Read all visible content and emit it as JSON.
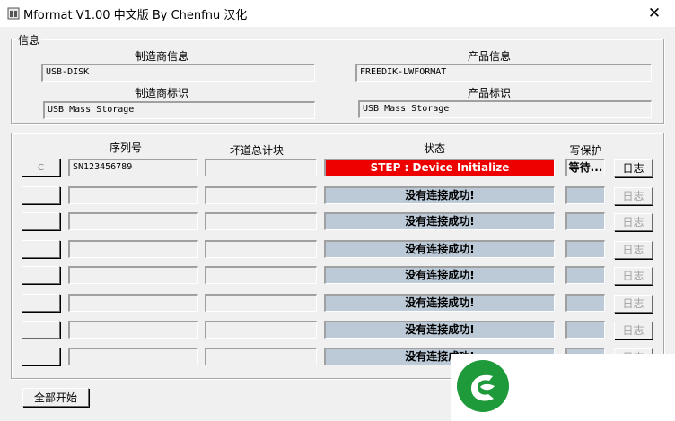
{
  "window": {
    "title": "Mformat V1.00 中文版 By Chenfnu 汉化",
    "close_glyph": "✕"
  },
  "info_group": {
    "legend": "信息",
    "manufacturer_info_label": "制造商信息",
    "manufacturer_info_value": "USB-DISK",
    "product_info_label": "产品信息",
    "product_info_value": "FREEDIK-LWFORMAT",
    "manufacturer_id_label": "制造商标识",
    "manufacturer_id_value": "USB Mass Storage",
    "product_id_label": "产品标识",
    "product_id_value": "USB Mass Storage"
  },
  "table": {
    "headers": {
      "serial": "序列号",
      "bad_blocks": "坏道总计块",
      "status": "状态",
      "write_protect": "写保护"
    },
    "log_label": "日志",
    "rows": [
      {
        "btn": "C",
        "serial": "SN123456789",
        "bad": "",
        "status": "STEP : Device Initialize",
        "wp": "等待...",
        "active": true
      },
      {
        "btn": "",
        "serial": "",
        "bad": "",
        "status": "没有连接成功!",
        "wp": "",
        "active": false
      },
      {
        "btn": "",
        "serial": "",
        "bad": "",
        "status": "没有连接成功!",
        "wp": "",
        "active": false
      },
      {
        "btn": "",
        "serial": "",
        "bad": "",
        "status": "没有连接成功!",
        "wp": "",
        "active": false
      },
      {
        "btn": "",
        "serial": "",
        "bad": "",
        "status": "没有连接成功!",
        "wp": "",
        "active": false
      },
      {
        "btn": "",
        "serial": "",
        "bad": "",
        "status": "没有连接成功!",
        "wp": "",
        "active": false
      },
      {
        "btn": "",
        "serial": "",
        "bad": "",
        "status": "没有连接成功!",
        "wp": "",
        "active": false
      },
      {
        "btn": "",
        "serial": "",
        "bad": "",
        "status": "没有连接成功!",
        "wp": "",
        "active": false
      }
    ]
  },
  "footer": {
    "start_all_label": "全部开始"
  },
  "colors": {
    "status_active": "#ee0000",
    "status_idle": "#bccad8",
    "logo_green": "#1f9a3a"
  },
  "icons": {
    "app": "app-icon",
    "watermark": "site-logo"
  }
}
